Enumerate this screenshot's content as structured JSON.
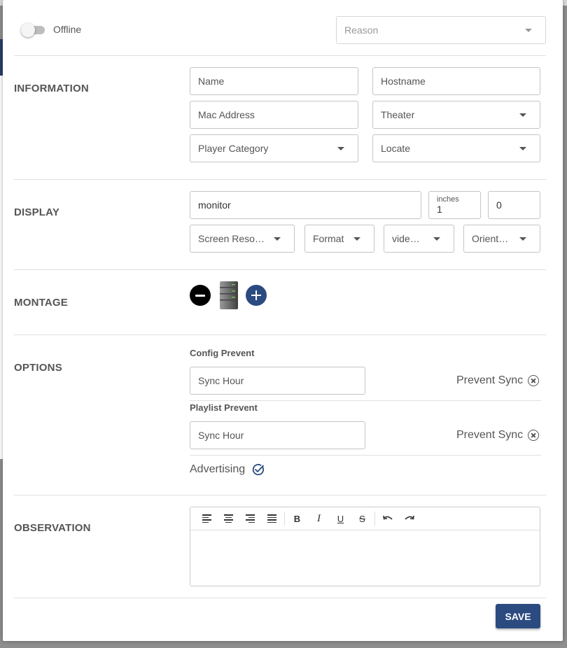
{
  "header": {
    "offline_label": "Offline",
    "reason_placeholder": "Reason"
  },
  "information": {
    "label": "INFORMATION",
    "name_placeholder": "Name",
    "hostname_placeholder": "Hostname",
    "mac_placeholder": "Mac Address",
    "theater_value": "Theater",
    "player_category_value": "Player Category",
    "locate_value": "Locate"
  },
  "display": {
    "label": "DISPLAY",
    "monitor_value": "monitor",
    "inches_label": "inches",
    "inches_value": "1",
    "extra_value": "0",
    "screen_resolution_value": "Screen Resol…",
    "format_value": "Format",
    "video_value": "video…",
    "orientation_value": "Orienta…"
  },
  "montage": {
    "label": "MONTAGE"
  },
  "options": {
    "label": "OPTIONS",
    "config_prevent_heading": "Config Prevent",
    "config_sync_placeholder": "Sync Hour",
    "config_prevent_sync": "Prevent Sync",
    "playlist_prevent_heading": "Playlist Prevent",
    "playlist_sync_placeholder": "Sync Hour",
    "playlist_prevent_sync": "Prevent Sync",
    "advertising_label": "Advertising"
  },
  "observation": {
    "label": "OBSERVATION",
    "toolbar_bold": "B",
    "toolbar_italic": "I",
    "toolbar_underline": "U",
    "toolbar_strike": "S"
  },
  "footer": {
    "save_label": "SAVE"
  },
  "colors": {
    "primary": "#2b4a80",
    "text": "#555555",
    "border": "#c4c4c4"
  }
}
